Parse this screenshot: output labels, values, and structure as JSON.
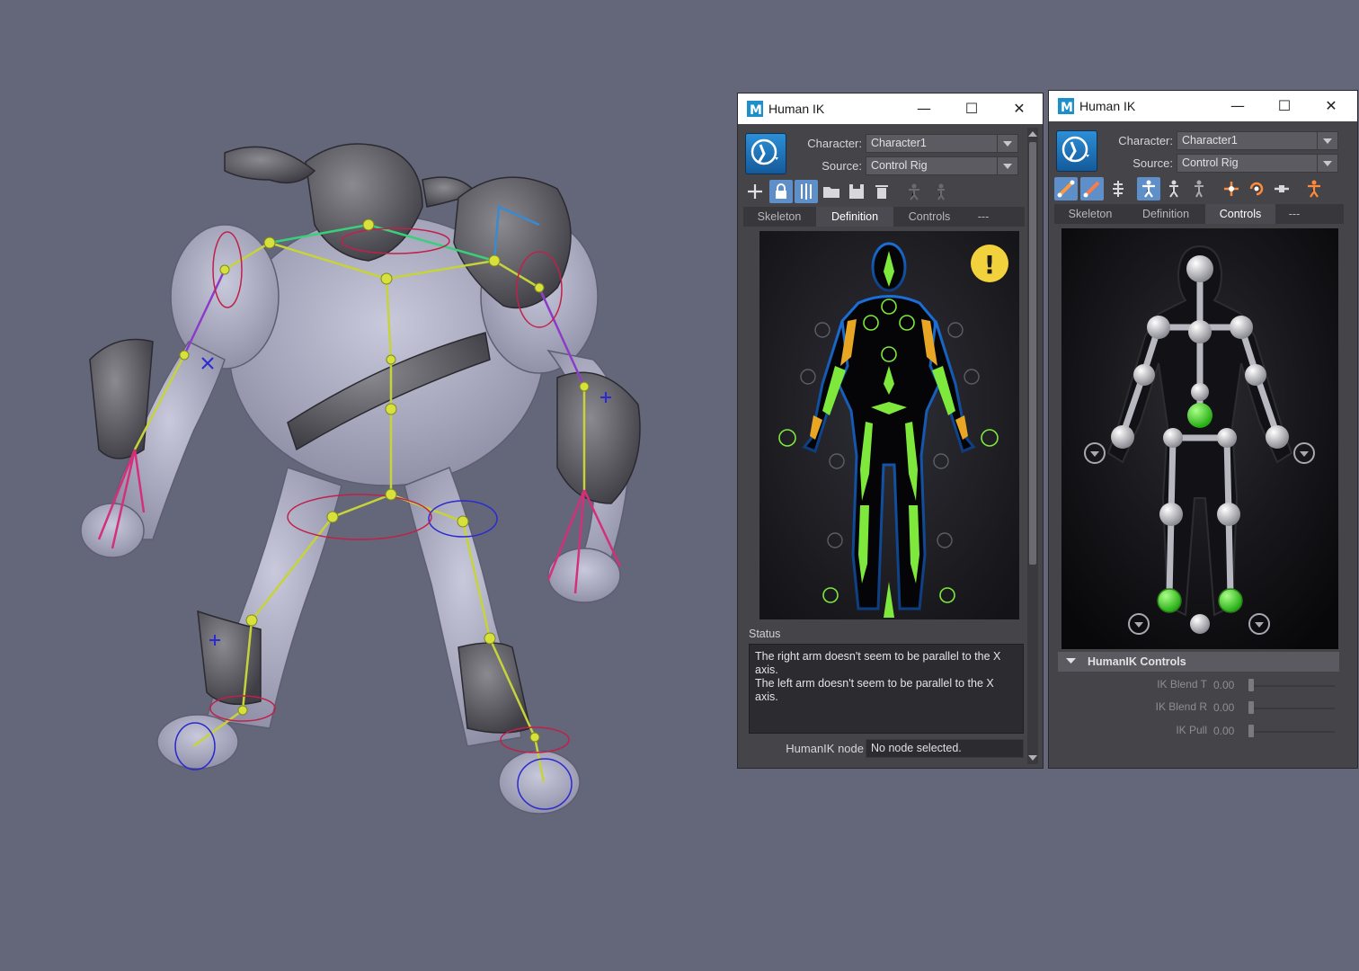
{
  "windows": [
    {
      "title": "Human IK",
      "character_label": "Character:",
      "character_value": "Character1",
      "source_label": "Source:",
      "source_value": "Control Rig",
      "tabs": [
        "Skeleton",
        "Definition",
        "Controls",
        "---"
      ],
      "active_tab": "Definition",
      "status_label": "Status",
      "status_lines": [
        "The right arm doesn't seem to be parallel to the X axis.",
        "The left arm doesn't seem to be parallel to the X axis."
      ],
      "humanik_node_label": "HumanIK node",
      "humanik_node_value": "No node selected.",
      "warning_symbol": "!"
    },
    {
      "title": "Human IK",
      "character_label": "Character:",
      "character_value": "Character1",
      "source_label": "Source:",
      "source_value": "Control Rig",
      "tabs": [
        "Skeleton",
        "Definition",
        "Controls",
        "---"
      ],
      "active_tab": "Controls",
      "controls_section_title": "HumanIK Controls",
      "sliders": [
        {
          "label": "IK Blend T",
          "value": "0.00"
        },
        {
          "label": "IK Blend R",
          "value": "0.00"
        },
        {
          "label": "IK Pull",
          "value": "0.00"
        }
      ]
    }
  ],
  "icons": {
    "titlebar": [
      "maya-logo-icon",
      "minimize-icon",
      "maximize-icon",
      "close-icon"
    ],
    "window1_toolbar": [
      "add-icon",
      "lock-icon",
      "mirror-icon",
      "open-folder-icon",
      "save-icon",
      "delete-icon",
      "pose-icon",
      "pose-icon"
    ],
    "window2_toolbar": [
      "full-body-ik-icon",
      "body-part-ik-icon",
      "spine-icon",
      "full-body-select-icon",
      "body-part-select-icon",
      "selection-icon",
      "pin-translate-icon",
      "pin-rotate-icon",
      "pin-none-icon",
      "stance-icon"
    ]
  },
  "colors": {
    "viewport_bg": "#64667a",
    "window_bg": "#444449",
    "active_tab": "#4a4a50",
    "active_tool": "#5e8fc9",
    "definition_green": "#7ee83c",
    "definition_orange": "#e8a624",
    "warning_yellow": "#f2d23c",
    "controls_green": "#44dd22"
  }
}
